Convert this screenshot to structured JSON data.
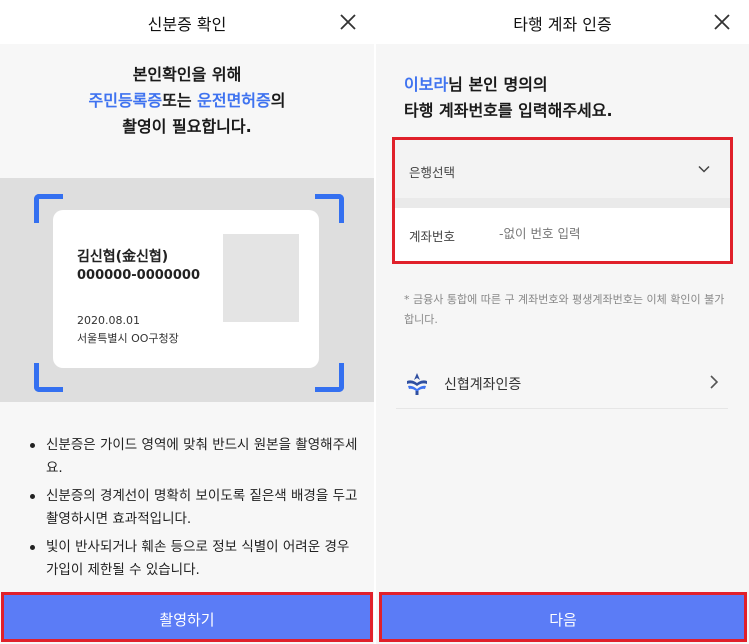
{
  "left": {
    "title": "신분증 확인",
    "intro": {
      "line1": "본인확인을 위해",
      "id_type_1": "주민등록증",
      "joiner": "또는 ",
      "id_type_2": "운전면허증",
      "suffix": "의",
      "line3": "촬영이 필요합니다."
    },
    "id_card": {
      "name": "김신협(金신협)",
      "number": "000000-0000000",
      "date": "2020.08.01",
      "issuer": "서울특별시 OO구청장"
    },
    "guidelines": [
      "신분증은 가이드 영역에 맞춰 반드시 원본을 촬영해주세요.",
      "신분증의 경계선이 명확히 보이도록 짙은색 배경을 두고 촬영하시면 효과적입니다.",
      "빛이 반사되거나 훼손 등으로 정보 식별이 어려운 경우가입이 제한될 수 있습니다."
    ],
    "button_label": "촬영하기"
  },
  "right": {
    "title": "타행 계좌 인증",
    "intro": {
      "user_name": "이보라",
      "line1_rest": "님 본인 명의의",
      "line2": "타행 계좌번호를 입력해주세요."
    },
    "bank_select": {
      "placeholder": "은행선택"
    },
    "account": {
      "label": "계좌번호",
      "value": "",
      "placeholder": "-없이 번호 입력"
    },
    "notice": "* 금융사 통합에 따른 구 계좌번호와 평생계좌번호는 이체 확인이 불가합니다.",
    "shinhyup": {
      "label": "신협계좌인증"
    },
    "button_label": "다음"
  },
  "icons": {
    "close": "close-icon",
    "chevron_down": "chevron-down-icon",
    "chevron_right": "chevron-right-icon",
    "logo": "shinhyup-logo-icon"
  },
  "colors": {
    "accent_blue": "#3f73f0",
    "button_blue": "#5b7cf6",
    "highlight_red": "#e0202a"
  }
}
